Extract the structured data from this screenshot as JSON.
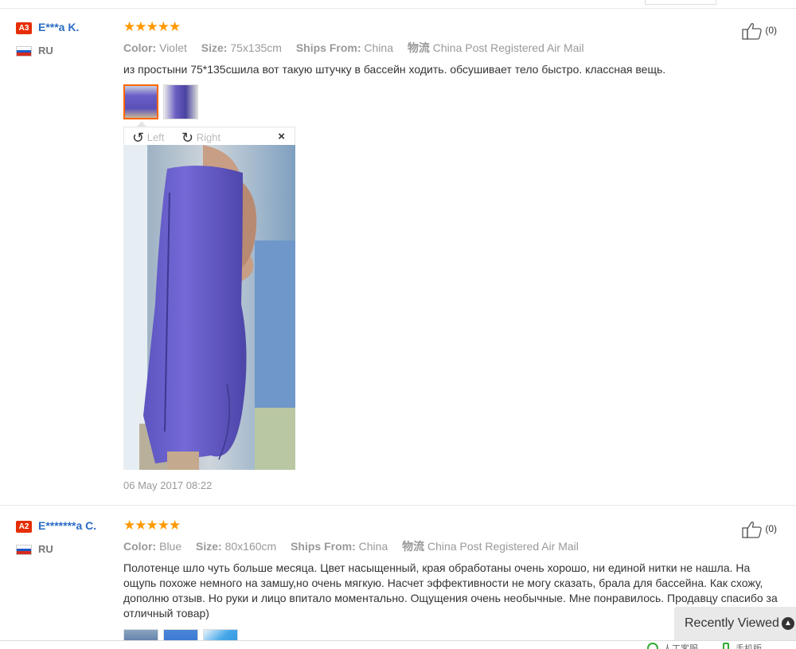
{
  "reviews": [
    {
      "level": "A3",
      "user": "E***a K.",
      "country": "RU",
      "stars": "★★★★★",
      "color_label": "Color:",
      "color": "Violet",
      "size_label": "Size:",
      "size": "75x135cm",
      "ships_label": "Ships From:",
      "ships": "China",
      "logistics_label": "物流",
      "logistics": "China Post Registered Air Mail",
      "text": "из простыни 75*135сшила вот такую штучку в бассейн ходить. обсушивает тело быстро. классная вещь.",
      "likes": "(0)",
      "date": "06 May 2017 08:22"
    },
    {
      "level": "A2",
      "user": "E*******a C.",
      "country": "RU",
      "stars": "★★★★★",
      "color_label": "Color:",
      "color": "Blue",
      "size_label": "Size:",
      "size": "80x160cm",
      "ships_label": "Ships From:",
      "ships": "China",
      "logistics_label": "物流",
      "logistics": "China Post Registered Air Mail",
      "text": "Полотенце шло чуть больше месяца. Цвет насыщенный, края обработаны очень хорошо, ни единой нитки не нашла. На ощупь похоже немного на замшу,но очень мягкую. Насчет эффективности не могу сказать, брала для бассейна. Как схожу, дополню отзыв. Но руки и лицо впитало моментально. Ощущения очень необычные. Мне понравилось. Продавцу спасибо за отличный товар)",
      "likes": "(0)"
    }
  ],
  "viewer": {
    "left_label": "Left",
    "right_label": "Right",
    "close": "×"
  },
  "recently_viewed": "Recently Viewed",
  "footer": {
    "item1": "人工客服",
    "item2": "手机版"
  },
  "colors": {
    "accent": "#f60",
    "star": "#f90",
    "username": "#2b6cc4",
    "badge": "#e62e04"
  }
}
